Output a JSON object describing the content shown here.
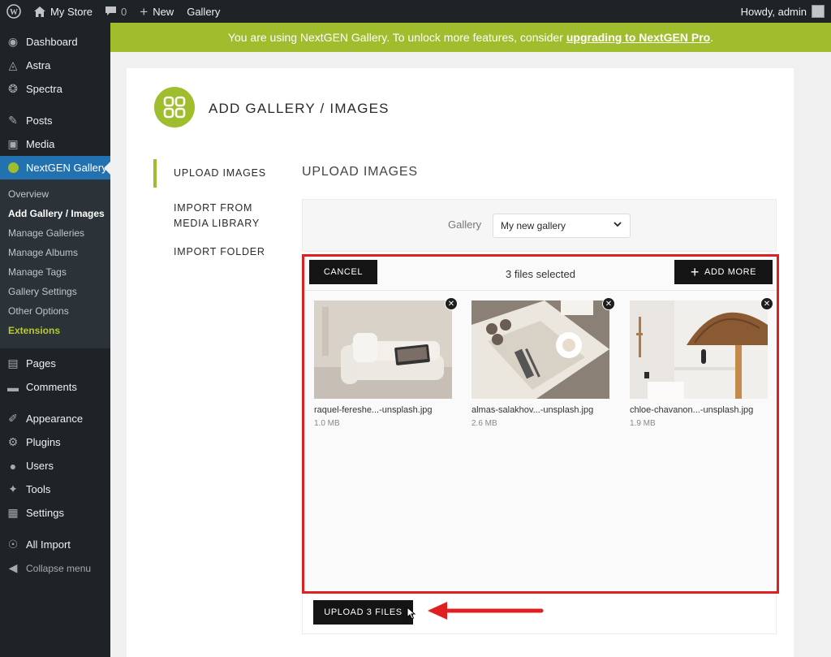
{
  "adminbar": {
    "site_name": "My Store",
    "comments_count": "0",
    "new_label": "New",
    "gallery_label": "Gallery",
    "howdy": "Howdy, admin"
  },
  "sidebar": {
    "items_top": [
      {
        "label": "Dashboard",
        "icon": "dashboard-icon"
      },
      {
        "label": "Astra",
        "icon": "astra-icon"
      },
      {
        "label": "Spectra",
        "icon": "spectra-icon"
      }
    ],
    "items_mid": [
      {
        "label": "Posts",
        "icon": "pin-icon"
      },
      {
        "label": "Media",
        "icon": "media-icon"
      }
    ],
    "active": {
      "label": "NextGEN Gallery",
      "icon": "nextgen-icon"
    },
    "submenu": [
      "Overview",
      "Add Gallery / Images",
      "Manage Galleries",
      "Manage Albums",
      "Manage Tags",
      "Gallery Settings",
      "Other Options",
      "Extensions"
    ],
    "items_bottom1": [
      {
        "label": "Pages",
        "icon": "pages-icon"
      },
      {
        "label": "Comments",
        "icon": "comment-icon"
      }
    ],
    "items_bottom2": [
      {
        "label": "Appearance",
        "icon": "brush-icon"
      },
      {
        "label": "Plugins",
        "icon": "plugin-icon"
      },
      {
        "label": "Users",
        "icon": "user-icon"
      },
      {
        "label": "Tools",
        "icon": "wrench-icon"
      },
      {
        "label": "Settings",
        "icon": "settings-icon"
      }
    ],
    "items_bottom3": [
      {
        "label": "All Import",
        "icon": "import-icon"
      },
      {
        "label": "Collapse menu",
        "icon": "collapse-icon"
      }
    ]
  },
  "notice": {
    "text": "You are using NextGEN Gallery. To unlock more features, consider",
    "link": "upgrading to NextGEN Pro",
    "suffix": "."
  },
  "page": {
    "title": "ADD GALLERY / IMAGES",
    "section_title": "UPLOAD IMAGES"
  },
  "tabs": [
    "UPLOAD IMAGES",
    "IMPORT FROM MEDIA LIBRARY",
    "IMPORT FOLDER"
  ],
  "gallery": {
    "label": "Gallery",
    "selected": "My new gallery"
  },
  "uploader": {
    "cancel_label": "CANCEL",
    "files_selected": "3 files selected",
    "add_more_label": "ADD MORE",
    "files": [
      {
        "name": "raquel-fereshe...-unsplash.jpg",
        "size": "1.0 MB"
      },
      {
        "name": "almas-salakhov...-unsplash.jpg",
        "size": "2.6 MB"
      },
      {
        "name": "chloe-chavanon...-unsplash.jpg",
        "size": "1.9 MB"
      }
    ],
    "upload_label": "UPLOAD 3 FILES"
  },
  "colors": {
    "accent_green": "#9fbd2c",
    "wp_blue": "#2271b1",
    "highlight_red": "#e02020",
    "admin_dark": "#1d2327"
  }
}
